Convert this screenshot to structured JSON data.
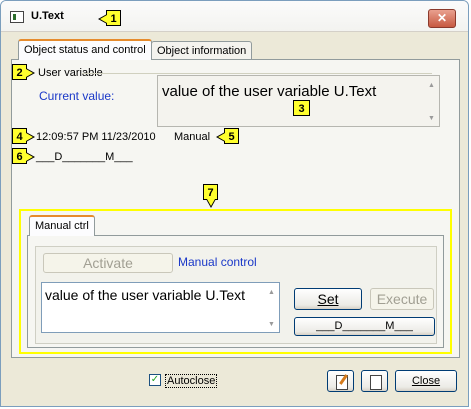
{
  "window": {
    "title": "U.Text"
  },
  "tabs": [
    {
      "label": "Object status and control",
      "active": true
    },
    {
      "label": "Object information",
      "active": false
    }
  ],
  "status": {
    "group_label": "User variable",
    "current_value_label": "Current value:",
    "current_value": "value of the user variable U.Text",
    "timestamp": "12:09:57 PM 11/23/2010",
    "source": "Manual",
    "flags": "___D_______M___"
  },
  "manual": {
    "tab_label": "Manual ctrl",
    "activate_label": "Activate",
    "mode_label": "Manual control",
    "input_value": "value of the user variable U.Text",
    "set_label": "Set",
    "execute_label": "Execute",
    "flags_button_label": "___D_______M___"
  },
  "footer": {
    "autoclose_label": "Autoclose",
    "autoclose_checked": true,
    "close_label": "Close"
  },
  "callouts": [
    "1",
    "2",
    "3",
    "4",
    "5",
    "6",
    "7"
  ],
  "colors": {
    "callout": "#ffff2e",
    "highlight_border": "#ffff00",
    "link_blue": "#1a38c8"
  },
  "icons": [
    "window-app-icon",
    "close-icon",
    "edit-document-icon",
    "copy-document-icon"
  ]
}
